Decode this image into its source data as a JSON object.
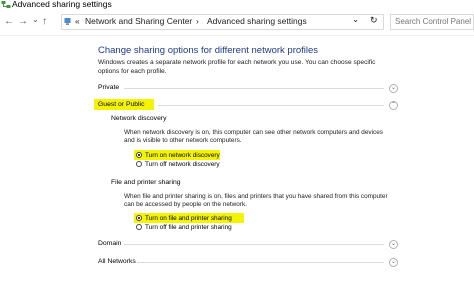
{
  "window": {
    "title": "Advanced sharing settings"
  },
  "nav": {
    "back": "←",
    "forward": "→",
    "recent": "⌄",
    "up": "↑",
    "breadcrumb_prefix": "«",
    "crumb1": "Network and Sharing Center",
    "crumb_sep": "›",
    "crumb2": "Advanced sharing settings",
    "dropdown": "⌄",
    "refresh": "↻",
    "search_placeholder": "Search Control Panel"
  },
  "main": {
    "heading": "Change sharing options for different network profiles",
    "intro": "Windows creates a separate network profile for each network you use. You can choose specific options for each profile.",
    "profiles": {
      "private": "Private",
      "guest_public": "Guest or Public",
      "domain": "Domain",
      "all_networks": "All Networks"
    },
    "network_discovery": {
      "title": "Network discovery",
      "description": "When network discovery is on, this computer can see other network computers and devices and is visible to other network computers.",
      "on": "Turn on network discovery",
      "off": "Turn off network discovery",
      "selected": "on"
    },
    "file_printer_sharing": {
      "title": "File and printer sharing",
      "description": "When file and printer sharing is on, files and printers that you have shared from this computer can be accessed by people on the network.",
      "on": "Turn on file and printer sharing",
      "off": "Turn off file and printer sharing",
      "selected": "on"
    }
  },
  "colors": {
    "heading": "#1e3a8a",
    "highlight": "#f4f400"
  },
  "icons": {
    "title": "network-sharing-icon",
    "chev_expand": "chevron-down-icon",
    "chev_collapse": "chevron-up-icon"
  }
}
